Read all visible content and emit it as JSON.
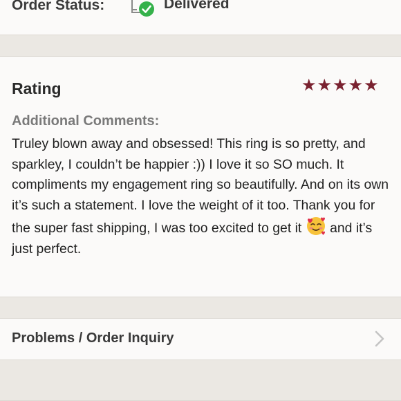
{
  "order_status": {
    "label": "Order Status:",
    "value": "Delivered",
    "icon": "delivered-check-icon",
    "check_color": "#35b14b"
  },
  "rating": {
    "title": "Rating",
    "stars": 5,
    "max_stars": 5,
    "star_color": "#7a2230",
    "comments_label": "Additional Comments:",
    "comment_before_emoji": "Truley blown away and obsessed! This ring is so pretty, and sparkley, I couldn’t be happier :)) I love it so SO much. It compliments my engagement ring so beautifully. And on its own it’s such a statement. I love the weight of it too. Thank you for the super fast shipping, I was too excited to get it",
    "emoji": "smiling-face-with-hearts-emoji",
    "comment_after_emoji": "and it’s just perfect."
  },
  "inquiry": {
    "label": "Problems / Order Inquiry",
    "icon": "chevron-right-icon"
  }
}
